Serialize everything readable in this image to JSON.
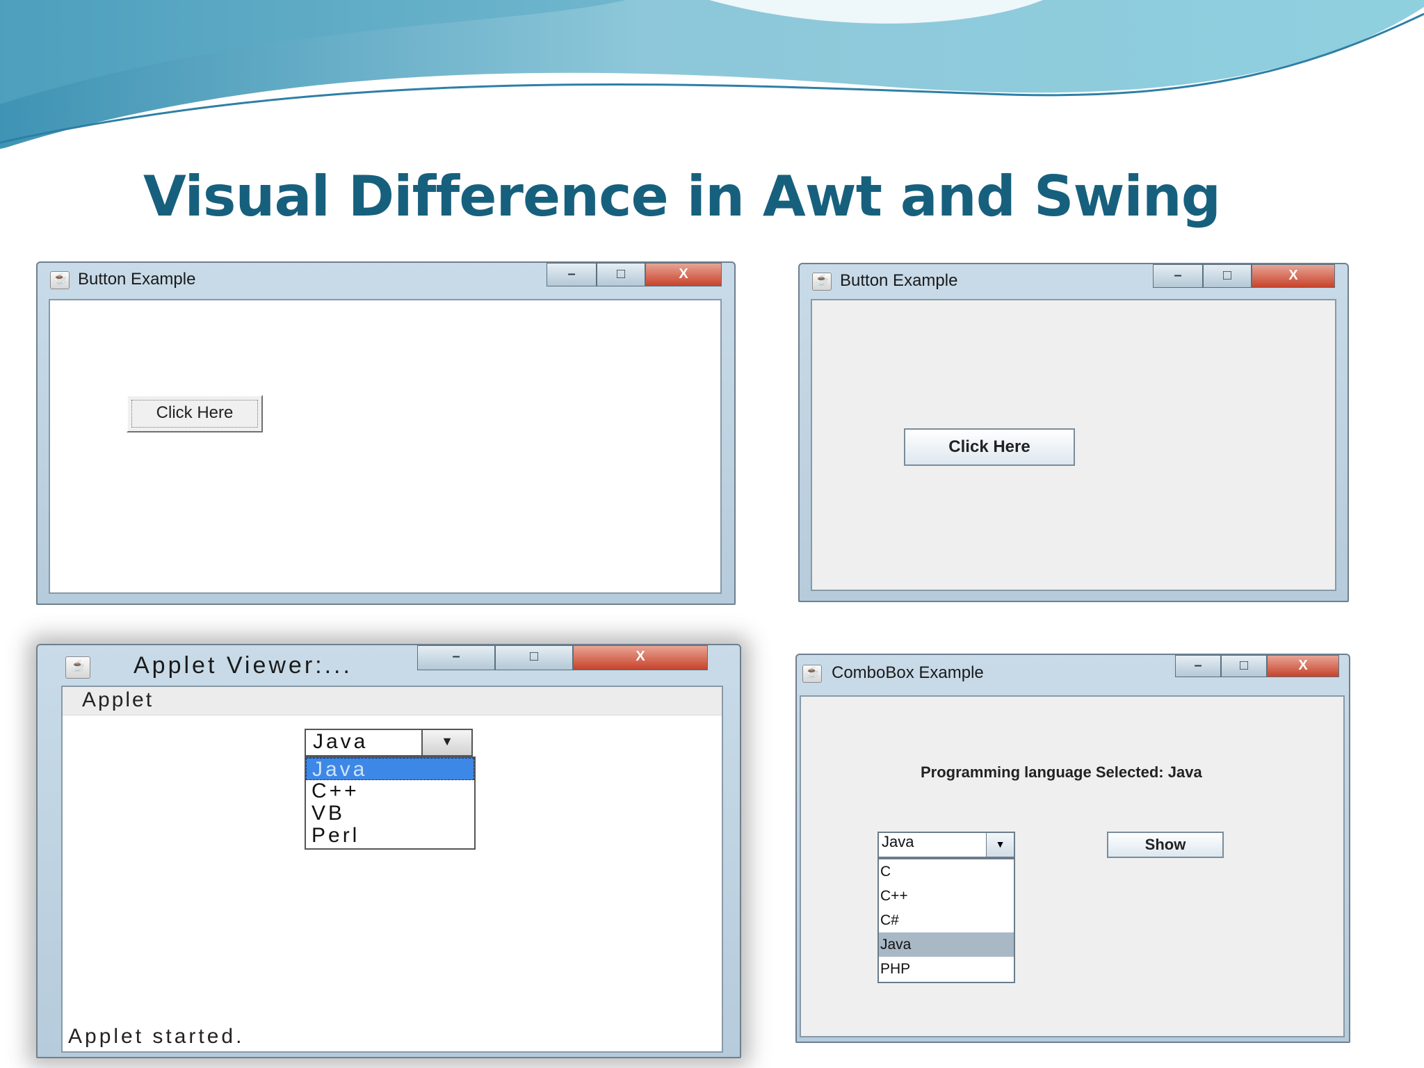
{
  "slide": {
    "title": "Visual Difference in Awt and Swing"
  },
  "window_buttons": {
    "minimize": "–",
    "maximize": "□",
    "close": "X"
  },
  "awt_button_window": {
    "title": "Button Example",
    "button_label": "Click Here"
  },
  "swing_button_window": {
    "title": "Button Example",
    "button_label": "Click Here"
  },
  "applet_viewer_window": {
    "title": "Applet Viewer:...",
    "menu": "Applet",
    "choice": {
      "selected": "Java",
      "arrow_icon": "dropdown-arrow"
    },
    "list_items": [
      {
        "label": "Java",
        "selected": true
      },
      {
        "label": "C++",
        "selected": false
      },
      {
        "label": "VB",
        "selected": false
      },
      {
        "label": "Perl",
        "selected": false
      }
    ],
    "status": "Applet started."
  },
  "combobox_window": {
    "title": "ComboBox Example",
    "selection_label": "Programming language Selected: Java",
    "combo": {
      "selected": "Java",
      "arrow_icon": "dropdown-arrow"
    },
    "list_items": [
      {
        "label": "C",
        "selected": false
      },
      {
        "label": "C++",
        "selected": false
      },
      {
        "label": "C#",
        "selected": false
      },
      {
        "label": "Java",
        "selected": true
      },
      {
        "label": "PHP",
        "selected": false
      }
    ],
    "show_button": "Show"
  },
  "colors": {
    "title": "#17607d",
    "wave_light": "#9ad4e0",
    "wave_dark": "#3f93b4",
    "list_highlight": "#3d87e6",
    "swing_list_highlight": "#a9b8c5"
  }
}
